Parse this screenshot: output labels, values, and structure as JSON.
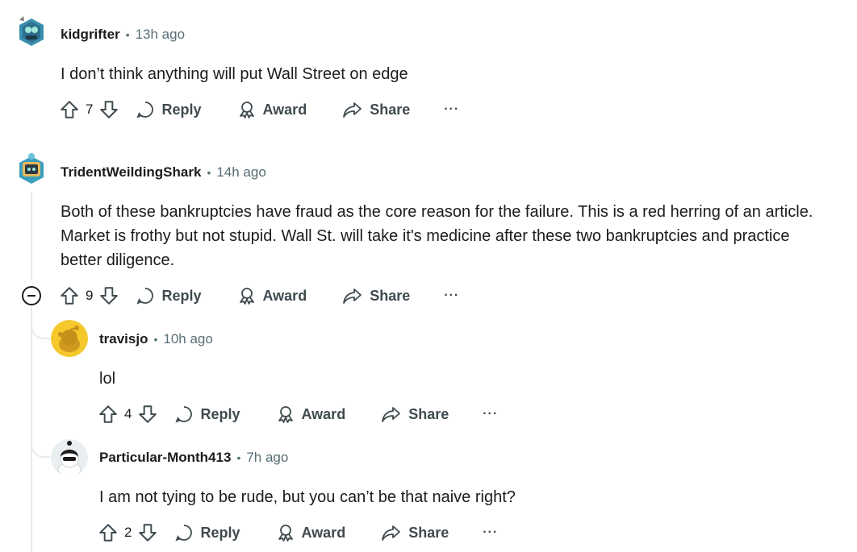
{
  "comments": [
    {
      "username": "kidgrifter",
      "time": "13h ago",
      "body": [
        "I don’t think anything will put Wall Street on edge"
      ],
      "votes": "7",
      "avatar_icon": "robot-snoo-avatar-icon"
    },
    {
      "username": "TridentWeildingShark",
      "time": "14h ago",
      "body": [
        "Both of these bankruptcies have fraud as the core reason for the failure. This is a red herring of an article.",
        "Market is frothy but not stupid. Wall St. will take it's medicine after these two bankruptcies and practice",
        "better diligence."
      ],
      "votes": "9",
      "avatar_icon": "tv-snoo-avatar-icon"
    },
    {
      "username": "travisjo",
      "time": "10h ago",
      "body": [
        "lol"
      ],
      "votes": "4",
      "avatar_icon": "default-snoo-avatar-icon"
    },
    {
      "username": "Particular-Month413",
      "time": "7h ago",
      "body": [
        "I am not tying to be rude, but you can’t be that naive right?"
      ],
      "votes": "2",
      "avatar_icon": "sunglasses-snoo-avatar-icon"
    }
  ],
  "actions": {
    "reply": "Reply",
    "award": "Award",
    "share": "Share",
    "more": "···"
  },
  "colors": {
    "text": "#1c1c1c",
    "meta": "#576f76",
    "thread_line": "#e5ebee",
    "default_avatar": "#f5c82c"
  }
}
